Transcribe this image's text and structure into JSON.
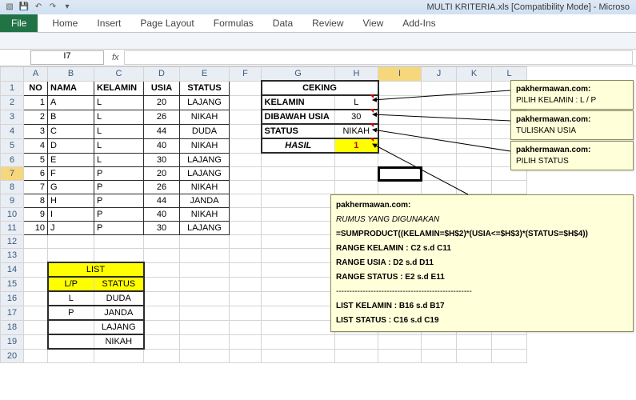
{
  "title": "MULTI KRITERIA.xls  [Compatibility Mode]  -  Microso",
  "ribbon": {
    "file": "File",
    "tabs": [
      "Home",
      "Insert",
      "Page Layout",
      "Formulas",
      "Data",
      "Review",
      "View",
      "Add-Ins"
    ]
  },
  "namebox": "I7",
  "fx": "fx",
  "cols": [
    "A",
    "B",
    "C",
    "D",
    "E",
    "F",
    "G",
    "H",
    "I",
    "J",
    "K",
    "L"
  ],
  "headers": {
    "no": "NO",
    "nama": "NAMA",
    "kelamin": "KELAMIN",
    "usia": "USIA",
    "status": "STATUS"
  },
  "rows": [
    {
      "no": "1",
      "nama": "A",
      "kel": "L",
      "usia": "20",
      "st": "LAJANG"
    },
    {
      "no": "2",
      "nama": "B",
      "kel": "L",
      "usia": "26",
      "st": "NIKAH"
    },
    {
      "no": "3",
      "nama": "C",
      "kel": "L",
      "usia": "44",
      "st": "DUDA"
    },
    {
      "no": "4",
      "nama": "D",
      "kel": "L",
      "usia": "40",
      "st": "NIKAH"
    },
    {
      "no": "5",
      "nama": "E",
      "kel": "L",
      "usia": "30",
      "st": "LAJANG"
    },
    {
      "no": "6",
      "nama": "F",
      "kel": "P",
      "usia": "20",
      "st": "LAJANG"
    },
    {
      "no": "7",
      "nama": "G",
      "kel": "P",
      "usia": "26",
      "st": "NIKAH"
    },
    {
      "no": "8",
      "nama": "H",
      "kel": "P",
      "usia": "44",
      "st": "JANDA"
    },
    {
      "no": "9",
      "nama": "I",
      "kel": "P",
      "usia": "40",
      "st": "NIKAH"
    },
    {
      "no": "10",
      "nama": "J",
      "kel": "P",
      "usia": "30",
      "st": "LAJANG"
    }
  ],
  "ceking": {
    "title": "CEKING",
    "kelamin_lbl": "KELAMIN",
    "kelamin": "L",
    "usia_lbl": "DIBAWAH USIA",
    "usia": "30",
    "status_lbl": "STATUS",
    "status": "NIKAH",
    "hasil_lbl": "HASIL",
    "hasil": "1"
  },
  "list": {
    "title": "LIST",
    "lp": "L/P",
    "status": "STATUS",
    "r": [
      [
        "L",
        "DUDA"
      ],
      [
        "P",
        "JANDA"
      ],
      [
        "",
        "LAJANG"
      ],
      [
        "",
        "NIKAH"
      ]
    ]
  },
  "comments": {
    "author": "pakhermawan.com:",
    "c1": "PILIH KELAMIN : L / P",
    "c2": "TULISKAN USIA",
    "c3": "PILIH STATUS",
    "big": {
      "l1": "RUMUS YANG DIGUNAKAN",
      "l2": "=SUMPRODUCT((KELAMIN=$H$2)*(USIA<=$H$3)*(STATUS=$H$4))",
      "l3": "RANGE KELAMIN : C2 s.d C11",
      "l4": "RANGE USIA : D2 s.d D11",
      "l5": "RANGE STATUS : E2 s.d E11",
      "l6": "---------------------------------------------------",
      "l7": "LIST KELAMIN : B16 s.d B17",
      "l8": "LIST STATUS : C16 s.d C19"
    }
  }
}
